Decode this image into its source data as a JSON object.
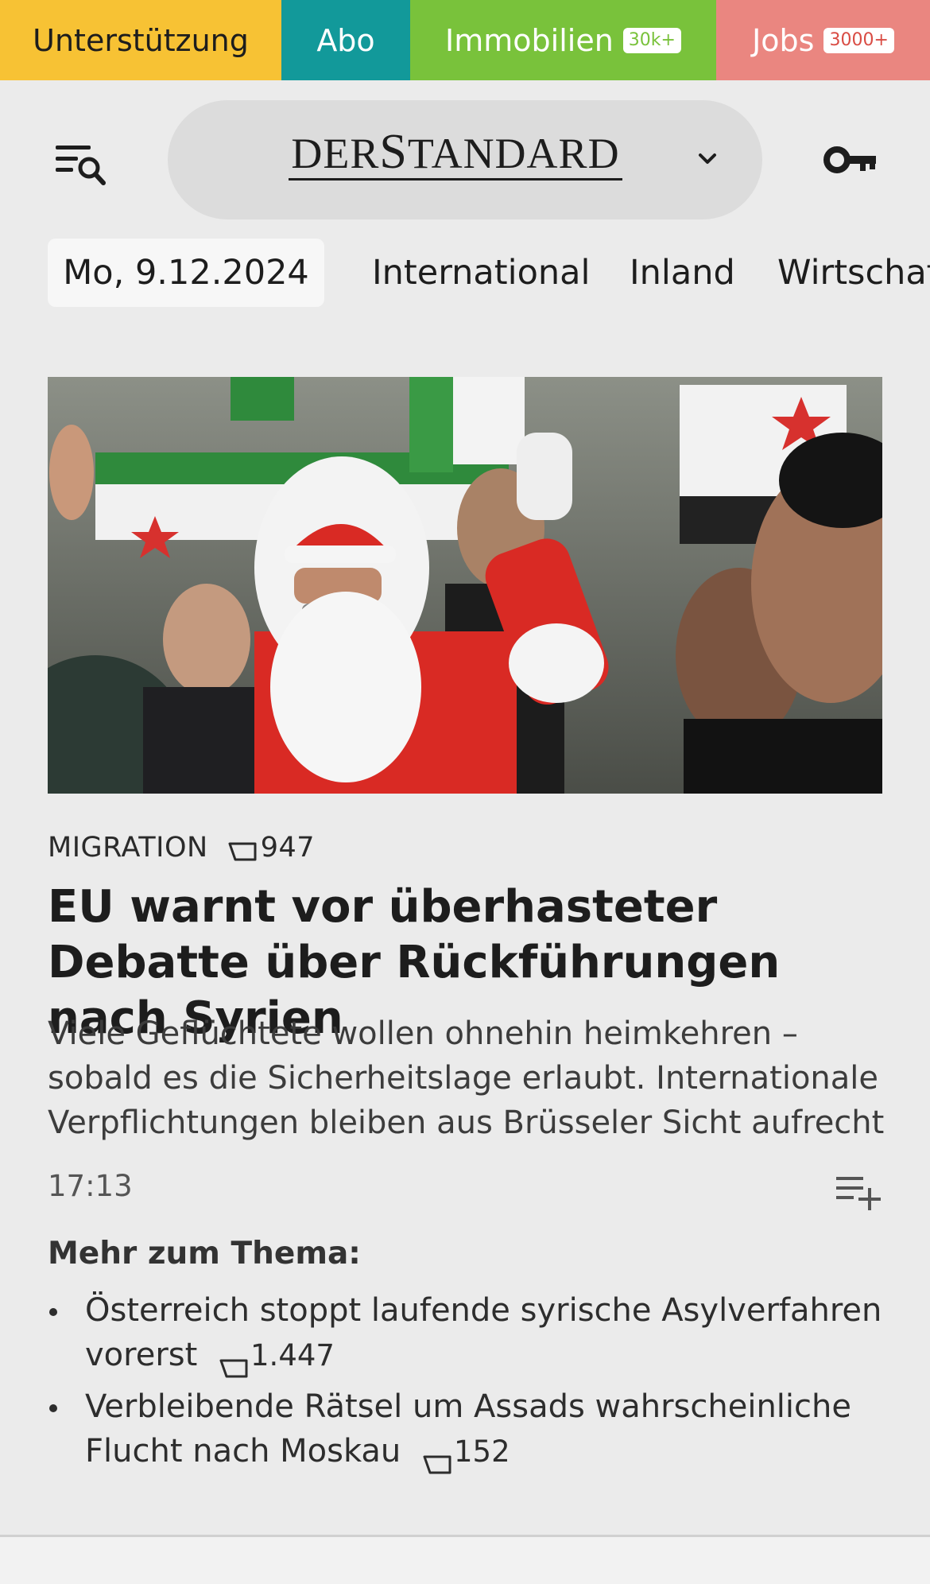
{
  "topbar": {
    "support": "Unterstützung",
    "abo": "Abo",
    "immobilien": "Immobilien",
    "immobilien_badge": "30k+",
    "jobs": "Jobs",
    "jobs_badge": "3000+"
  },
  "header": {
    "logo_part1": "DER",
    "logo_part2": "S",
    "logo_part3": "TANDARD"
  },
  "nav": {
    "date": "Mo, 9.12.2024",
    "items": [
      "International",
      "Inland",
      "Wirtschaft"
    ]
  },
  "article": {
    "kicker": "MIGRATION",
    "comment_count": "947",
    "headline": "EU warnt vor überhasteter Debatte über Rückführungen nach Syrien",
    "teaser": "Viele Geflüchtete wollen ohnehin heimkehren – sobald es die Sicherheitslage erlaubt. Internationale Verpflichtungen bleiben aus Brüsseler Sicht aufrecht",
    "time": "17:13"
  },
  "more": {
    "title": "Mehr zum Thema:",
    "items": [
      {
        "text": "Österreich stoppt laufende syrische Asylverfahren vorerst",
        "count": "1.447"
      },
      {
        "text": "Verbleibende Rätsel um Assads wahrscheinliche Flucht nach Moskau",
        "count": "152"
      }
    ]
  },
  "icons": {
    "menu": "menu-search-icon",
    "chevron": "chevron-down-icon",
    "key": "key-icon",
    "comment": "comment-icon",
    "playlist": "playlist-add-icon"
  },
  "colors": {
    "support": "#f7c234",
    "abo": "#12999a",
    "immobilien": "#79c23b",
    "jobs": "#ea8680",
    "background": "#ebebeb"
  }
}
